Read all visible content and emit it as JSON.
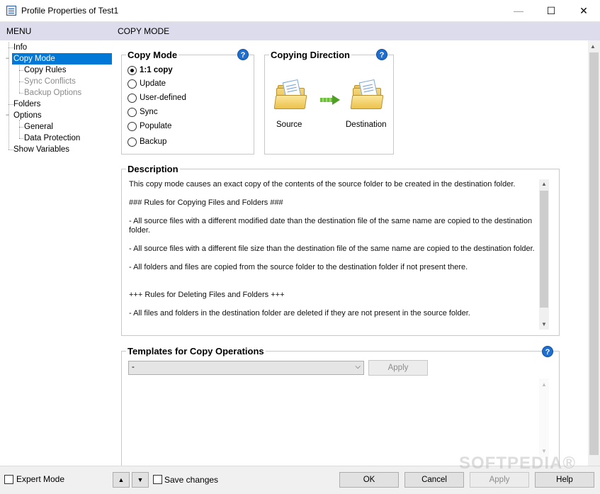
{
  "window": {
    "title": "Profile Properties of Test1",
    "controls": {
      "minimize": "—",
      "maximize": "☐",
      "close": "✕"
    }
  },
  "header": {
    "menu_label": "MENU",
    "section_label": "COPY MODE"
  },
  "tree": {
    "items": [
      {
        "label": "Info",
        "state": "normal"
      },
      {
        "label": "Copy Mode",
        "state": "selected"
      },
      {
        "label": "Copy Rules",
        "state": "normal"
      },
      {
        "label": "Sync Conflicts",
        "state": "disabled"
      },
      {
        "label": "Backup Options",
        "state": "disabled"
      },
      {
        "label": "Folders",
        "state": "normal"
      },
      {
        "label": "Options",
        "state": "normal"
      },
      {
        "label": "General",
        "state": "normal"
      },
      {
        "label": "Data Protection",
        "state": "normal"
      },
      {
        "label": "Show Variables",
        "state": "normal"
      }
    ],
    "expander_minus": "−"
  },
  "copy_mode": {
    "title": "Copy Mode",
    "help": "?",
    "options": [
      "1:1 copy",
      "Update",
      "User-defined",
      "Sync",
      "Populate",
      "Backup"
    ],
    "selected": "1:1 copy"
  },
  "copying_direction": {
    "title": "Copying Direction",
    "help": "?",
    "source_label": "Source",
    "destination_label": "Destination"
  },
  "description": {
    "title": "Description",
    "paragraphs": [
      "This copy mode causes an exact copy of the contents of the source folder to be created in the destination folder.",
      "### Rules for Copying Files and Folders ###",
      "- All source files with a different modified date than the destination file of the same name are copied to the destination folder.",
      "- All source files with a different file size than the destination file of the same name are copied to the destination folder.",
      "- All folders and files are copied from the source folder to the destination folder if not present there.",
      "+++ Rules for Deleting Files and Folders +++",
      "- All files and folders in the destination folder are deleted if they are not present in the source folder."
    ]
  },
  "templates": {
    "title": "Templates for Copy Operations",
    "help": "?",
    "selected_value": "-",
    "apply_label": "Apply"
  },
  "bottom": {
    "expert_mode_label": "Expert Mode",
    "up_arrow": "▲",
    "down_arrow": "▼",
    "save_changes_label": "Save changes",
    "ok_label": "OK",
    "cancel_label": "Cancel",
    "apply_label": "Apply",
    "help_label": "Help"
  },
  "watermark": "SOFTPEDIA®"
}
